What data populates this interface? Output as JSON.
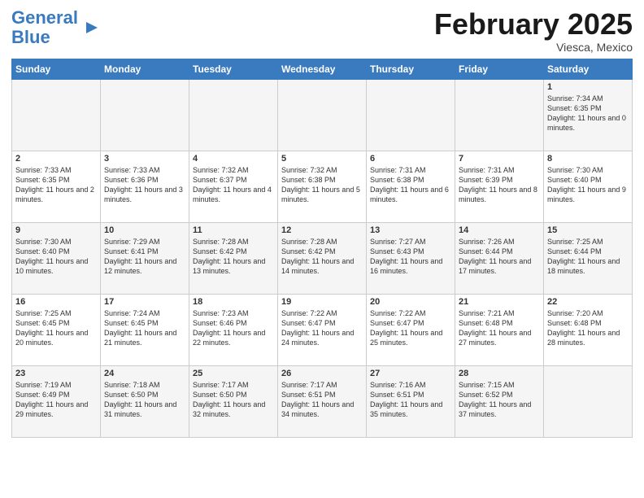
{
  "logo": {
    "text_general": "General",
    "text_blue": "Blue"
  },
  "header": {
    "month": "February 2025",
    "location": "Viesca, Mexico"
  },
  "days_of_week": [
    "Sunday",
    "Monday",
    "Tuesday",
    "Wednesday",
    "Thursday",
    "Friday",
    "Saturday"
  ],
  "weeks": [
    [
      {
        "day": "",
        "info": ""
      },
      {
        "day": "",
        "info": ""
      },
      {
        "day": "",
        "info": ""
      },
      {
        "day": "",
        "info": ""
      },
      {
        "day": "",
        "info": ""
      },
      {
        "day": "",
        "info": ""
      },
      {
        "day": "1",
        "info": "Sunrise: 7:34 AM\nSunset: 6:35 PM\nDaylight: 11 hours and 0 minutes."
      }
    ],
    [
      {
        "day": "2",
        "info": "Sunrise: 7:33 AM\nSunset: 6:35 PM\nDaylight: 11 hours and 2 minutes."
      },
      {
        "day": "3",
        "info": "Sunrise: 7:33 AM\nSunset: 6:36 PM\nDaylight: 11 hours and 3 minutes."
      },
      {
        "day": "4",
        "info": "Sunrise: 7:32 AM\nSunset: 6:37 PM\nDaylight: 11 hours and 4 minutes."
      },
      {
        "day": "5",
        "info": "Sunrise: 7:32 AM\nSunset: 6:38 PM\nDaylight: 11 hours and 5 minutes."
      },
      {
        "day": "6",
        "info": "Sunrise: 7:31 AM\nSunset: 6:38 PM\nDaylight: 11 hours and 6 minutes."
      },
      {
        "day": "7",
        "info": "Sunrise: 7:31 AM\nSunset: 6:39 PM\nDaylight: 11 hours and 8 minutes."
      },
      {
        "day": "8",
        "info": "Sunrise: 7:30 AM\nSunset: 6:40 PM\nDaylight: 11 hours and 9 minutes."
      }
    ],
    [
      {
        "day": "9",
        "info": "Sunrise: 7:30 AM\nSunset: 6:40 PM\nDaylight: 11 hours and 10 minutes."
      },
      {
        "day": "10",
        "info": "Sunrise: 7:29 AM\nSunset: 6:41 PM\nDaylight: 11 hours and 12 minutes."
      },
      {
        "day": "11",
        "info": "Sunrise: 7:28 AM\nSunset: 6:42 PM\nDaylight: 11 hours and 13 minutes."
      },
      {
        "day": "12",
        "info": "Sunrise: 7:28 AM\nSunset: 6:42 PM\nDaylight: 11 hours and 14 minutes."
      },
      {
        "day": "13",
        "info": "Sunrise: 7:27 AM\nSunset: 6:43 PM\nDaylight: 11 hours and 16 minutes."
      },
      {
        "day": "14",
        "info": "Sunrise: 7:26 AM\nSunset: 6:44 PM\nDaylight: 11 hours and 17 minutes."
      },
      {
        "day": "15",
        "info": "Sunrise: 7:25 AM\nSunset: 6:44 PM\nDaylight: 11 hours and 18 minutes."
      }
    ],
    [
      {
        "day": "16",
        "info": "Sunrise: 7:25 AM\nSunset: 6:45 PM\nDaylight: 11 hours and 20 minutes."
      },
      {
        "day": "17",
        "info": "Sunrise: 7:24 AM\nSunset: 6:45 PM\nDaylight: 11 hours and 21 minutes."
      },
      {
        "day": "18",
        "info": "Sunrise: 7:23 AM\nSunset: 6:46 PM\nDaylight: 11 hours and 22 minutes."
      },
      {
        "day": "19",
        "info": "Sunrise: 7:22 AM\nSunset: 6:47 PM\nDaylight: 11 hours and 24 minutes."
      },
      {
        "day": "20",
        "info": "Sunrise: 7:22 AM\nSunset: 6:47 PM\nDaylight: 11 hours and 25 minutes."
      },
      {
        "day": "21",
        "info": "Sunrise: 7:21 AM\nSunset: 6:48 PM\nDaylight: 11 hours and 27 minutes."
      },
      {
        "day": "22",
        "info": "Sunrise: 7:20 AM\nSunset: 6:48 PM\nDaylight: 11 hours and 28 minutes."
      }
    ],
    [
      {
        "day": "23",
        "info": "Sunrise: 7:19 AM\nSunset: 6:49 PM\nDaylight: 11 hours and 29 minutes."
      },
      {
        "day": "24",
        "info": "Sunrise: 7:18 AM\nSunset: 6:50 PM\nDaylight: 11 hours and 31 minutes."
      },
      {
        "day": "25",
        "info": "Sunrise: 7:17 AM\nSunset: 6:50 PM\nDaylight: 11 hours and 32 minutes."
      },
      {
        "day": "26",
        "info": "Sunrise: 7:17 AM\nSunset: 6:51 PM\nDaylight: 11 hours and 34 minutes."
      },
      {
        "day": "27",
        "info": "Sunrise: 7:16 AM\nSunset: 6:51 PM\nDaylight: 11 hours and 35 minutes."
      },
      {
        "day": "28",
        "info": "Sunrise: 7:15 AM\nSunset: 6:52 PM\nDaylight: 11 hours and 37 minutes."
      },
      {
        "day": "",
        "info": ""
      }
    ]
  ]
}
